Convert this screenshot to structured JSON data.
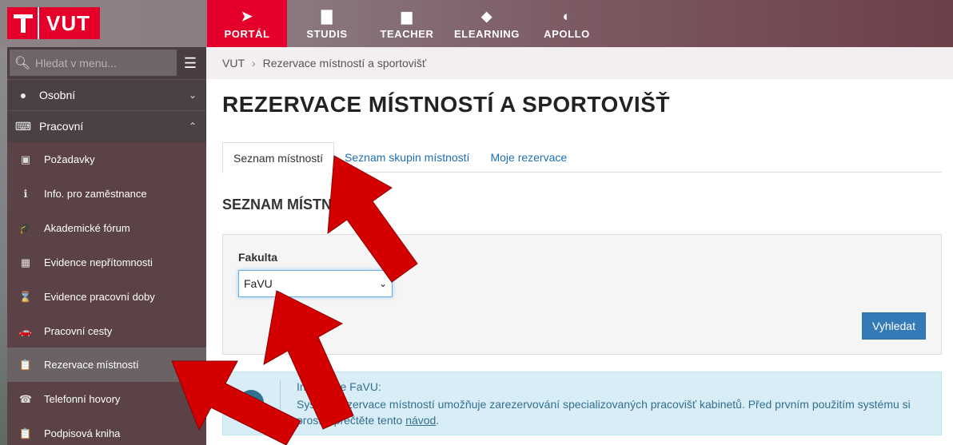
{
  "logo": {
    "text": "VUT"
  },
  "nav": [
    {
      "label": "PORTÁL",
      "icon": "➤",
      "active": true
    },
    {
      "label": "STUDIS",
      "icon": "▇"
    },
    {
      "label": "TEACHER",
      "icon": "▆"
    },
    {
      "label": "ELEARNING",
      "icon": "◆"
    },
    {
      "label": "APOLLO",
      "icon": "◐"
    }
  ],
  "search": {
    "placeholder": "Hledat v menu..."
  },
  "sidebar": {
    "sections": [
      {
        "label": "Osobní",
        "icon": "👤"
      },
      {
        "label": "Pracovní",
        "icon": "⌨"
      }
    ],
    "items": [
      {
        "label": "Požadavky",
        "icon": "▣"
      },
      {
        "label": "Info. pro zaměstnance",
        "icon": "ℹ"
      },
      {
        "label": "Akademické fórum",
        "icon": "🎓"
      },
      {
        "label": "Evidence nepřítomnosti",
        "icon": "▦"
      },
      {
        "label": "Evidence pracovní doby",
        "icon": "⌛"
      },
      {
        "label": "Pracovní cesty",
        "icon": "🚗"
      },
      {
        "label": "Rezervace místností",
        "icon": "📋"
      },
      {
        "label": "Telefonní hovory",
        "icon": "☎"
      },
      {
        "label": "Podpisová kniha",
        "icon": "📋"
      }
    ]
  },
  "breadcrumb": {
    "root": "VUT",
    "current": "Rezervace místností a sportovišť"
  },
  "page": {
    "title": "REZERVACE MÍSTNOSTÍ A SPORTOVIŠŤ"
  },
  "tabs": [
    "Seznam místností",
    "Seznam skupin místností",
    "Moje rezervace"
  ],
  "section": {
    "title": "SEZNAM MÍSTNOSTÍ"
  },
  "filter": {
    "label": "Fakulta",
    "value": "FaVU",
    "button": "Vyhledat"
  },
  "info": {
    "title": "Informace FaVU:",
    "text": "Systém rezervace místností umožňuje zarezervování specializovaných pracovišť kabinetů. Před prvním použitím systému si prosím přečtěte tento ",
    "link": "návod",
    "end": "."
  }
}
